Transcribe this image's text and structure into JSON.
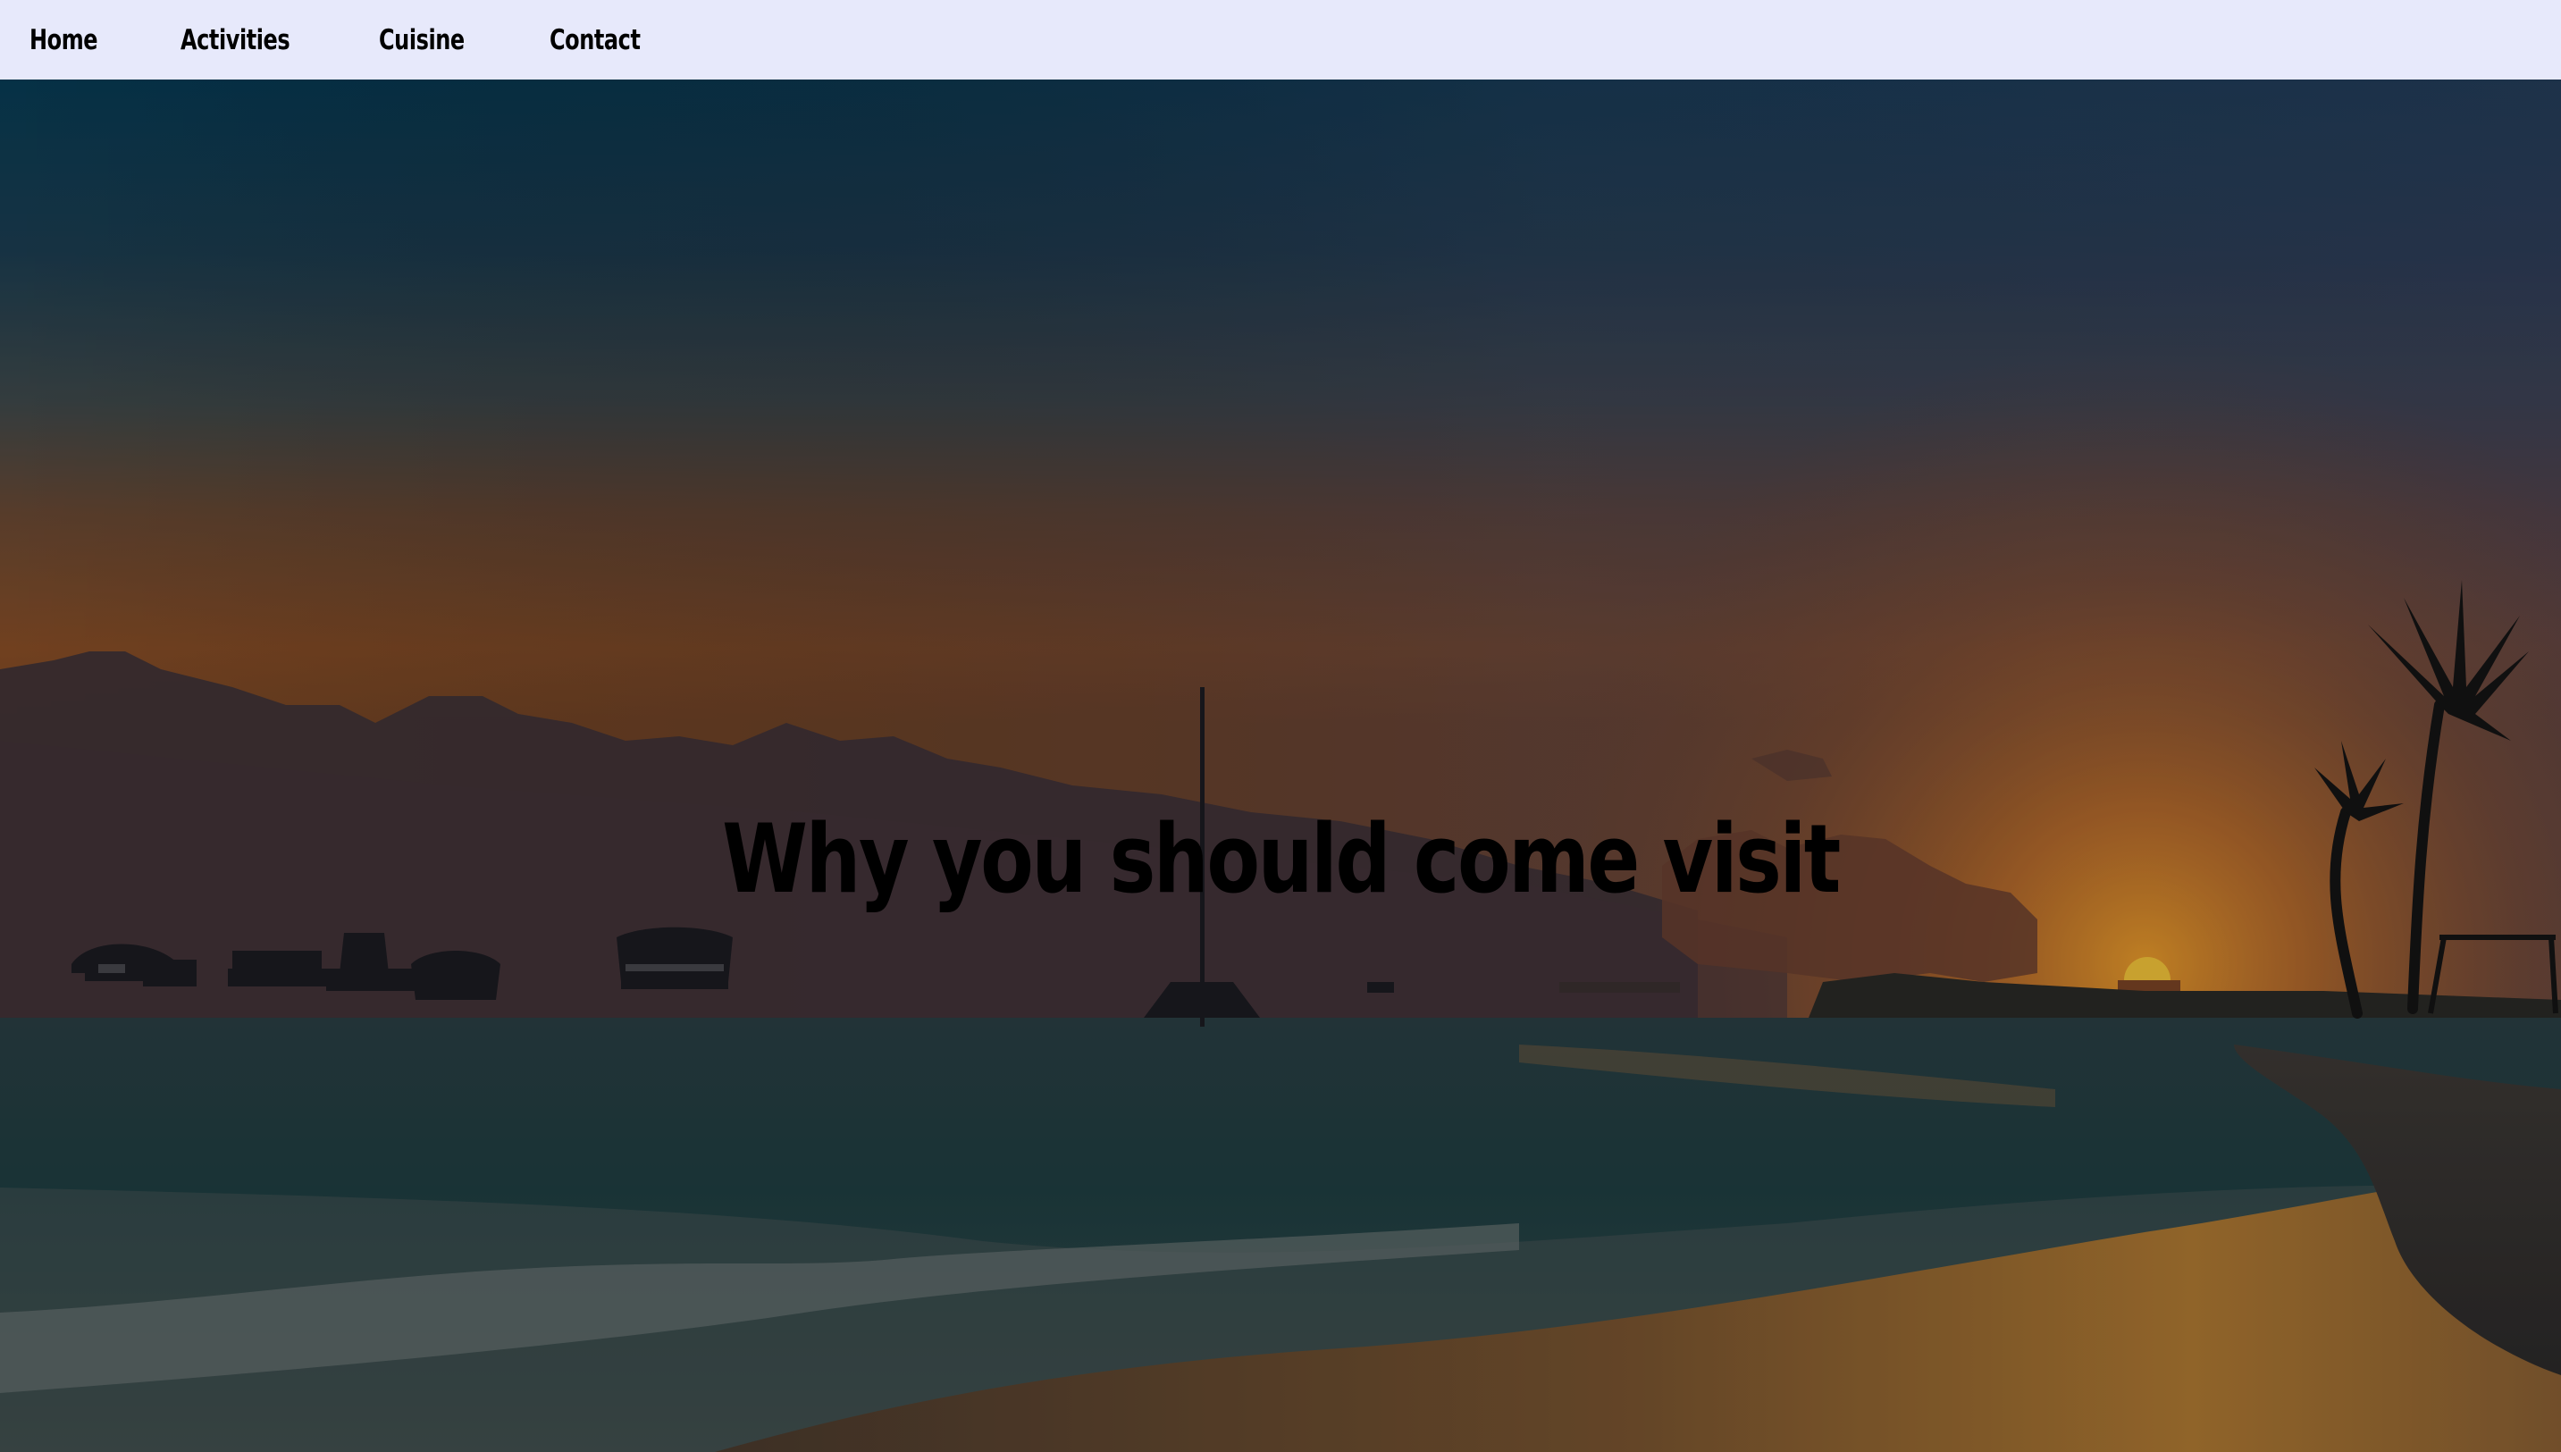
{
  "nav": {
    "items": [
      {
        "label": "Home"
      },
      {
        "label": "Activities"
      },
      {
        "label": "Cuisine"
      },
      {
        "label": "Contact"
      }
    ]
  },
  "hero": {
    "title": "Why you should come visit"
  },
  "colors": {
    "navbar_bg": "#e7e9fb",
    "sky_top": "#0b3a52",
    "sky_mid": "#3d4a50",
    "sunset_orange": "#a8581c",
    "sea": "#1f3c3e",
    "sand": "#8a5a2a"
  }
}
